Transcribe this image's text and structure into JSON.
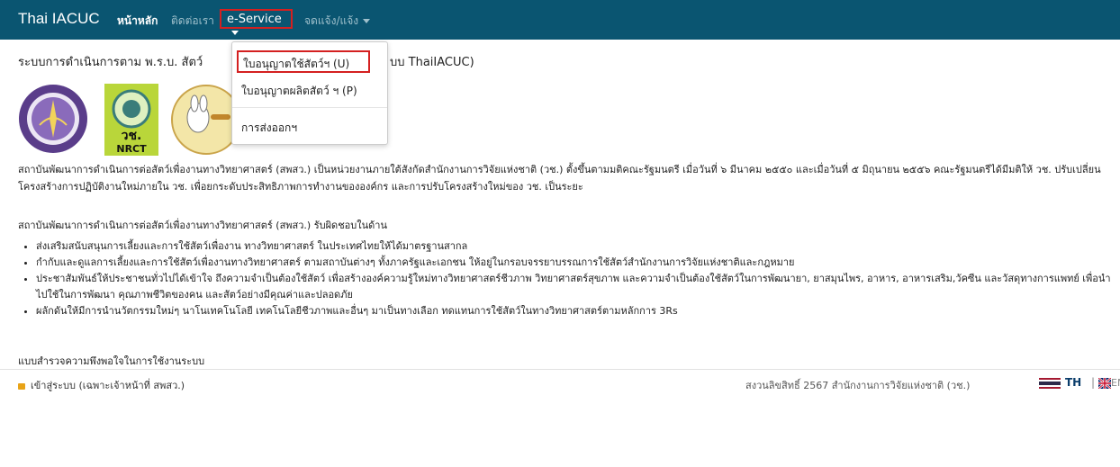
{
  "navbar": {
    "brand": "Thai IACUC",
    "home": "หน้าหลัก",
    "contact": "ติดต่อเรา",
    "eservice": "e-Service",
    "report": "จดแจ้ง/แจ้ง"
  },
  "subtitle": {
    "start": "ระบบการดำเนินการตาม พ.ร.บ. สัตว์",
    "end": "บบ ThaiIACUC)"
  },
  "dropdown": {
    "items": [
      "ใบอนุญาตใช้สัตว์ฯ (U)",
      "ใบอนุญาตผลิตสัตว์ ฯ (P)",
      "การส่งออกฯ"
    ]
  },
  "logos": {
    "nrct_text": "วช.",
    "nrct_en": "NRCT"
  },
  "content": {
    "para1": "สถาบันพัฒนาการดำเนินการต่อสัตว์เพื่องานทางวิทยาศาสตร์ (สพสว.) เป็นหน่วยงานภายใต้สังกัดสำนักงานการวิจัยแห่งชาติ (วช.) ตั้งขึ้นตามมติคณะรัฐมนตรี เมื่อวันที่ ๖ มีนาคม ๒๕๕๐ และเมื่อวันที่ ๕ มิถุนายน ๒๕๕๖ คณะรัฐมนตรีได้มีมติให้ วช. ปรับเปลี่ยนโครงสร้างการปฏิบัติงานใหม่ภายใน วช. เพื่อยกระดับประสิทธิภาพการทำงานขององค์กร และการปรับโครงสร้างใหม่ของ วช. เป็นระยะ",
    "para2": "สถาบันพัฒนาการดำเนินการต่อสัตว์เพื่องานทางวิทยาศาสตร์ (สพสว.) รับผิดชอบในด้าน",
    "responsibilities": [
      "ส่งเสริมสนับสนุนการเลี้ยงและการใช้สัตว์เพื่องาน ทางวิทยาศาสตร์ ในประเทศไทยให้ได้มาตรฐานสากล",
      "กำกับและดูแลการเลี้ยงและการใช้สัตว์เพื่องานทางวิทยาศาสตร์ ตามสถาบันต่างๆ ทั้งภาครัฐและเอกชน ให้อยู่ในกรอบจรรยาบรรณการใช้สัตว์สำนักงานการวิจัยแห่งชาติและกฎหมาย",
      "ประชาสัมพันธ์ให้ประชาชนทั่วไปได้เข้าใจ ถึงความจำเป็นต้องใช้สัตว์ เพื่อสร้างองค์ความรู้ใหม่ทางวิทยาศาสตร์ชีวภาพ วิทยาศาสตร์สุขภาพ และความจำเป็นต้องใช้สัตว์ในการพัฒนายา, ยาสมุนไพร, อาหาร, อาหารเสริม,วัคซีน และวัสดุทางการแพทย์ เพื่อนำไปใช้ในการพัฒนา คุณภาพชีวิตของคน และสัตว์อย่างมีคุณค่าและปลอดภัย",
      "ผลักดันให้มีการนำนวัตกรรมใหม่ๆ นาโนเทคโนโลยี เทคโนโลยีชีวภาพและอื่นๆ มาเป็นทางเลือก ทดแทนการใช้สัตว์ในทางวิทยาศาสตร์ตามหลักการ 3Rs"
    ],
    "survey": "แบบสำรวจความพึงพอใจในการใช้งานระบบ"
  },
  "footer": {
    "login": "เข้าสู่ระบบ (เฉพาะเจ้าหน้าที่ สพสว.)",
    "copyright": "สงวนลิขสิทธิ์ 2567 สำนักงานการวิจัยแห่งชาติ (วช.)",
    "lang_th": "TH",
    "separator": "|",
    "lang_en": "EN"
  },
  "colors": {
    "navbar": "#0a5571",
    "highlight": "#d42020",
    "nrct_green": "#b9d63a",
    "logo_purple": "#5a3d8a"
  }
}
